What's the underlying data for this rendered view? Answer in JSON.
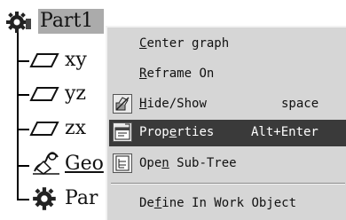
{
  "tree": {
    "root_label": "Part1",
    "nodes": [
      {
        "label": "xy",
        "icon": "plane-icon"
      },
      {
        "label": "yz",
        "icon": "plane-icon"
      },
      {
        "label": "zx",
        "icon": "plane-icon"
      },
      {
        "label": "Geo",
        "icon": "geometrical-set-icon"
      },
      {
        "label": "Par",
        "icon": "parameters-gear-icon"
      }
    ]
  },
  "context_menu": {
    "items": [
      {
        "id": "center-graph",
        "label": "Center graph",
        "mnemonic": "C",
        "rest": "enter graph",
        "shortcut": ""
      },
      {
        "id": "reframe-on",
        "label": "Reframe On",
        "mnemonic": "R",
        "rest": "eframe On",
        "shortcut": ""
      },
      {
        "id": "hide-show",
        "label": "Hide/Show",
        "mnemonic": "H",
        "rest": "ide/Show",
        "shortcut": "space",
        "icon": "hide-show-icon"
      },
      {
        "id": "properties",
        "label": "Properties",
        "pre": "Prop",
        "mnemonic": "e",
        "post": "rties",
        "shortcut": "Alt+Enter",
        "icon": "properties-icon",
        "highlighted": true
      },
      {
        "id": "open-sub-tree",
        "label": "Open Sub-Tree",
        "pre": "Ope",
        "mnemonic": "n",
        "post": " Sub-Tree",
        "shortcut": "",
        "icon": "sub-tree-icon"
      },
      {
        "id": "define-in-work-object",
        "label": "Define In Work Object",
        "pre": "De",
        "mnemonic": "f",
        "post": "ine In Work Object",
        "shortcut": ""
      }
    ]
  }
}
